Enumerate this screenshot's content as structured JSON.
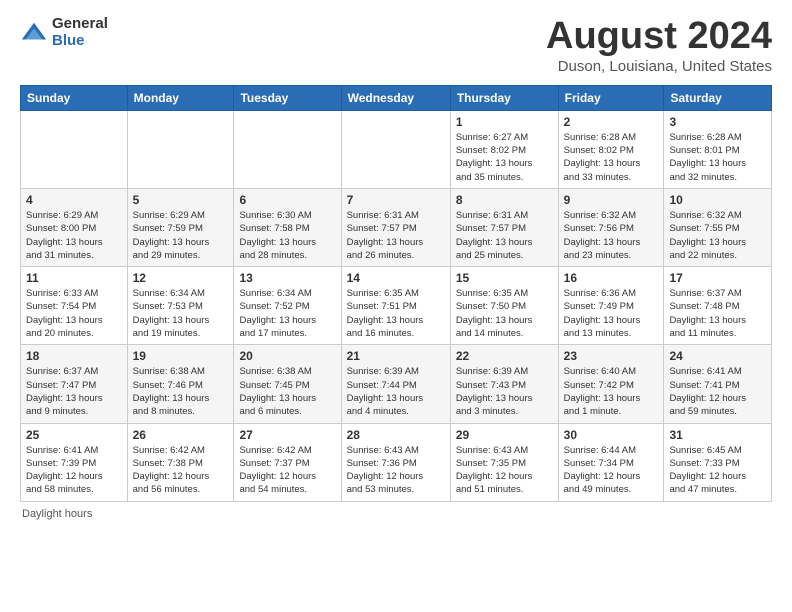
{
  "header": {
    "logo_general": "General",
    "logo_blue": "Blue",
    "month_title": "August 2024",
    "location": "Duson, Louisiana, United States"
  },
  "days_of_week": [
    "Sunday",
    "Monday",
    "Tuesday",
    "Wednesday",
    "Thursday",
    "Friday",
    "Saturday"
  ],
  "weeks": [
    [
      {
        "day": "",
        "info": ""
      },
      {
        "day": "",
        "info": ""
      },
      {
        "day": "",
        "info": ""
      },
      {
        "day": "",
        "info": ""
      },
      {
        "day": "1",
        "info": "Sunrise: 6:27 AM\nSunset: 8:02 PM\nDaylight: 13 hours\nand 35 minutes."
      },
      {
        "day": "2",
        "info": "Sunrise: 6:28 AM\nSunset: 8:02 PM\nDaylight: 13 hours\nand 33 minutes."
      },
      {
        "day": "3",
        "info": "Sunrise: 6:28 AM\nSunset: 8:01 PM\nDaylight: 13 hours\nand 32 minutes."
      }
    ],
    [
      {
        "day": "4",
        "info": "Sunrise: 6:29 AM\nSunset: 8:00 PM\nDaylight: 13 hours\nand 31 minutes."
      },
      {
        "day": "5",
        "info": "Sunrise: 6:29 AM\nSunset: 7:59 PM\nDaylight: 13 hours\nand 29 minutes."
      },
      {
        "day": "6",
        "info": "Sunrise: 6:30 AM\nSunset: 7:58 PM\nDaylight: 13 hours\nand 28 minutes."
      },
      {
        "day": "7",
        "info": "Sunrise: 6:31 AM\nSunset: 7:57 PM\nDaylight: 13 hours\nand 26 minutes."
      },
      {
        "day": "8",
        "info": "Sunrise: 6:31 AM\nSunset: 7:57 PM\nDaylight: 13 hours\nand 25 minutes."
      },
      {
        "day": "9",
        "info": "Sunrise: 6:32 AM\nSunset: 7:56 PM\nDaylight: 13 hours\nand 23 minutes."
      },
      {
        "day": "10",
        "info": "Sunrise: 6:32 AM\nSunset: 7:55 PM\nDaylight: 13 hours\nand 22 minutes."
      }
    ],
    [
      {
        "day": "11",
        "info": "Sunrise: 6:33 AM\nSunset: 7:54 PM\nDaylight: 13 hours\nand 20 minutes."
      },
      {
        "day": "12",
        "info": "Sunrise: 6:34 AM\nSunset: 7:53 PM\nDaylight: 13 hours\nand 19 minutes."
      },
      {
        "day": "13",
        "info": "Sunrise: 6:34 AM\nSunset: 7:52 PM\nDaylight: 13 hours\nand 17 minutes."
      },
      {
        "day": "14",
        "info": "Sunrise: 6:35 AM\nSunset: 7:51 PM\nDaylight: 13 hours\nand 16 minutes."
      },
      {
        "day": "15",
        "info": "Sunrise: 6:35 AM\nSunset: 7:50 PM\nDaylight: 13 hours\nand 14 minutes."
      },
      {
        "day": "16",
        "info": "Sunrise: 6:36 AM\nSunset: 7:49 PM\nDaylight: 13 hours\nand 13 minutes."
      },
      {
        "day": "17",
        "info": "Sunrise: 6:37 AM\nSunset: 7:48 PM\nDaylight: 13 hours\nand 11 minutes."
      }
    ],
    [
      {
        "day": "18",
        "info": "Sunrise: 6:37 AM\nSunset: 7:47 PM\nDaylight: 13 hours\nand 9 minutes."
      },
      {
        "day": "19",
        "info": "Sunrise: 6:38 AM\nSunset: 7:46 PM\nDaylight: 13 hours\nand 8 minutes."
      },
      {
        "day": "20",
        "info": "Sunrise: 6:38 AM\nSunset: 7:45 PM\nDaylight: 13 hours\nand 6 minutes."
      },
      {
        "day": "21",
        "info": "Sunrise: 6:39 AM\nSunset: 7:44 PM\nDaylight: 13 hours\nand 4 minutes."
      },
      {
        "day": "22",
        "info": "Sunrise: 6:39 AM\nSunset: 7:43 PM\nDaylight: 13 hours\nand 3 minutes."
      },
      {
        "day": "23",
        "info": "Sunrise: 6:40 AM\nSunset: 7:42 PM\nDaylight: 13 hours\nand 1 minute."
      },
      {
        "day": "24",
        "info": "Sunrise: 6:41 AM\nSunset: 7:41 PM\nDaylight: 12 hours\nand 59 minutes."
      }
    ],
    [
      {
        "day": "25",
        "info": "Sunrise: 6:41 AM\nSunset: 7:39 PM\nDaylight: 12 hours\nand 58 minutes."
      },
      {
        "day": "26",
        "info": "Sunrise: 6:42 AM\nSunset: 7:38 PM\nDaylight: 12 hours\nand 56 minutes."
      },
      {
        "day": "27",
        "info": "Sunrise: 6:42 AM\nSunset: 7:37 PM\nDaylight: 12 hours\nand 54 minutes."
      },
      {
        "day": "28",
        "info": "Sunrise: 6:43 AM\nSunset: 7:36 PM\nDaylight: 12 hours\nand 53 minutes."
      },
      {
        "day": "29",
        "info": "Sunrise: 6:43 AM\nSunset: 7:35 PM\nDaylight: 12 hours\nand 51 minutes."
      },
      {
        "day": "30",
        "info": "Sunrise: 6:44 AM\nSunset: 7:34 PM\nDaylight: 12 hours\nand 49 minutes."
      },
      {
        "day": "31",
        "info": "Sunrise: 6:45 AM\nSunset: 7:33 PM\nDaylight: 12 hours\nand 47 minutes."
      }
    ]
  ],
  "footer": {
    "daylight_label": "Daylight hours"
  }
}
